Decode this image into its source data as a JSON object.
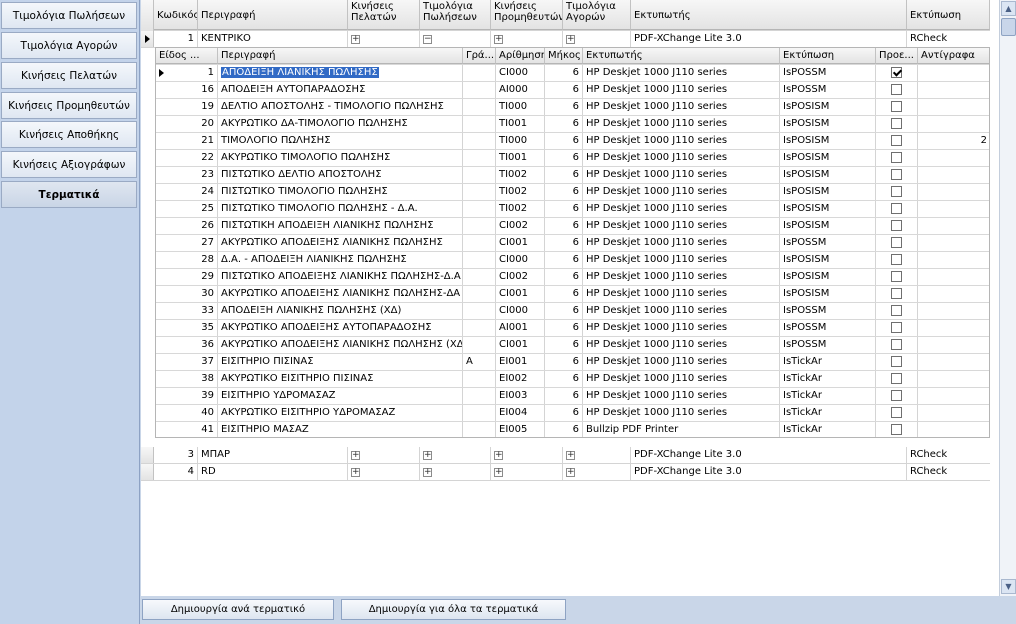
{
  "sidebar": {
    "items": [
      {
        "label": "Τιμολόγια Πωλήσεων"
      },
      {
        "label": "Τιμολόγια Αγορών"
      },
      {
        "label": "Κινήσεις Πελατών"
      },
      {
        "label": "Κινήσεις Προμηθευτών"
      },
      {
        "label": "Κινήσεις Αποθήκης"
      },
      {
        "label": "Κινήσεις Αξιογράφων"
      },
      {
        "label": "Τερματικά"
      }
    ],
    "active_index": 6
  },
  "outer_grid": {
    "headers": [
      "Κωδικός",
      "Περιγραφή",
      "Κινήσεις Πελατών",
      "Τιμολόγια Πωλήσεων",
      "Κινήσεις Προμηθευτών",
      "Τιμολόγια Αγορών",
      "Εκτυπωτής",
      "Εκτύπωση"
    ],
    "rows": [
      {
        "code": "1",
        "description": "ΚΕΝΤΡΙΚΟ",
        "printer": "PDF-XChange Lite 3.0",
        "print": "RCheck",
        "expanded_col": 3
      },
      {
        "code": "3",
        "description": "ΜΠΑΡ",
        "printer": "PDF-XChange Lite 3.0",
        "print": "RCheck",
        "expanded_col": 0
      },
      {
        "code": "4",
        "description": "RD",
        "printer": "PDF-XChange Lite 3.0",
        "print": "RCheck",
        "expanded_col": 0
      }
    ]
  },
  "detail_grid": {
    "headers": [
      "Είδος ...",
      "Περιγραφή",
      "Γρά...",
      "Αρίθμηση",
      "Μήκος",
      "Εκτυπωτής",
      "Εκτύπωση",
      "Προε...",
      "Αντίγραφα"
    ],
    "rows": [
      {
        "type": "1",
        "description": "ΑΠΟΔΕΙΞΗ ΛΙΑΝΙΚΗΣ ΠΩΛΗΣΗΣ",
        "letter": "",
        "numbering": "CI000",
        "length": "6",
        "printer": "HP Deskjet 1000 J110 series",
        "print": "IsPOSSM",
        "default": true,
        "copies": "",
        "selected": true
      },
      {
        "type": "16",
        "description": "ΑΠΟΔΕΙΞΗ ΑΥΤΟΠΑΡΑΔΟΣΗΣ",
        "letter": "",
        "numbering": "AI000",
        "length": "6",
        "printer": "HP Deskjet 1000 J110 series",
        "print": "IsPOSSM",
        "default": false,
        "copies": ""
      },
      {
        "type": "19",
        "description": "ΔΕΛΤΙΟ ΑΠΟΣΤΟΛΗΣ - ΤΙΜΟΛΟΓΙΟ ΠΩΛΗΣΗΣ",
        "letter": "",
        "numbering": "TI000",
        "length": "6",
        "printer": "HP Deskjet 1000 J110 series",
        "print": "IsPOSISM",
        "default": false,
        "copies": ""
      },
      {
        "type": "20",
        "description": "ΑΚΥΡΩΤΙΚΟ ΔΑ-ΤΙΜΟΛΟΓΙΟ ΠΩΛΗΣΗΣ",
        "letter": "",
        "numbering": "TI001",
        "length": "6",
        "printer": "HP Deskjet 1000 J110 series",
        "print": "IsPOSISM",
        "default": false,
        "copies": ""
      },
      {
        "type": "21",
        "description": "ΤΙΜΟΛΟΓΙΟ ΠΩΛΗΣΗΣ",
        "letter": "",
        "numbering": "TI000",
        "length": "6",
        "printer": "HP Deskjet 1000 J110 series",
        "print": "IsPOSISM",
        "default": false,
        "copies": "2"
      },
      {
        "type": "22",
        "description": "ΑΚΥΡΩΤΙΚΟ ΤΙΜΟΛΟΓΙΟ ΠΩΛΗΣΗΣ",
        "letter": "",
        "numbering": "TI001",
        "length": "6",
        "printer": "HP Deskjet 1000 J110 series",
        "print": "IsPOSISM",
        "default": false,
        "copies": ""
      },
      {
        "type": "23",
        "description": "ΠΙΣΤΩΤΙΚΟ ΔΕΛΤΙΟ ΑΠΟΣΤΟΛΗΣ",
        "letter": "",
        "numbering": "TI002",
        "length": "6",
        "printer": "HP Deskjet 1000 J110 series",
        "print": "IsPOSISM",
        "default": false,
        "copies": ""
      },
      {
        "type": "24",
        "description": "ΠΙΣΤΩΤΙΚΟ ΤΙΜΟΛΟΓΙΟ ΠΩΛΗΣΗΣ",
        "letter": "",
        "numbering": "TI002",
        "length": "6",
        "printer": "HP Deskjet 1000 J110 series",
        "print": "IsPOSISM",
        "default": false,
        "copies": ""
      },
      {
        "type": "25",
        "description": "ΠΙΣΤΩΤΙΚΟ ΤΙΜΟΛΟΓΙΟ ΠΩΛΗΣΗΣ - Δ.Α.",
        "letter": "",
        "numbering": "TI002",
        "length": "6",
        "printer": "HP Deskjet 1000 J110 series",
        "print": "IsPOSISM",
        "default": false,
        "copies": ""
      },
      {
        "type": "26",
        "description": "ΠΙΣΤΩΤΙΚΗ ΑΠΟΔΕΙΞΗ ΛΙΑΝΙΚΗΣ ΠΩΛΗΣΗΣ",
        "letter": "",
        "numbering": "CI002",
        "length": "6",
        "printer": "HP Deskjet 1000 J110 series",
        "print": "IsPOSISM",
        "default": false,
        "copies": ""
      },
      {
        "type": "27",
        "description": "ΑΚΥΡΩΤΙΚΟ ΑΠΟΔΕΙΞΗΣ ΛΙΑΝΙΚΗΣ ΠΩΛΗΣΗΣ",
        "letter": "",
        "numbering": "CI001",
        "length": "6",
        "printer": "HP Deskjet 1000 J110 series",
        "print": "IsPOSSM",
        "default": false,
        "copies": ""
      },
      {
        "type": "28",
        "description": "Δ.Α. - ΑΠΟΔΕΙΞΗ ΛΙΑΝΙΚΗΣ ΠΩΛΗΣΗΣ",
        "letter": "",
        "numbering": "CI000",
        "length": "6",
        "printer": "HP Deskjet 1000 J110 series",
        "print": "IsPOSISM",
        "default": false,
        "copies": ""
      },
      {
        "type": "29",
        "description": "ΠΙΣΤΩΤΙΚΟ ΑΠΟΔΕΙΞΗΣ ΛΙΑΝΙΚΗΣ ΠΩΛΗΣΗΣ-Δ.Α",
        "letter": "",
        "numbering": "CI002",
        "length": "6",
        "printer": "HP Deskjet 1000 J110 series",
        "print": "IsPOSISM",
        "default": false,
        "copies": ""
      },
      {
        "type": "30",
        "description": "ΑΚΥΡΩΤΙΚΟ ΑΠΟΔΕΙΞΗΣ ΛΙΑΝΙΚΗΣ ΠΩΛΗΣΗΣ-ΔΑ",
        "letter": "",
        "numbering": "CI001",
        "length": "6",
        "printer": "HP Deskjet 1000 J110 series",
        "print": "IsPOSISM",
        "default": false,
        "copies": ""
      },
      {
        "type": "33",
        "description": "ΑΠΟΔΕΙΞΗ ΛΙΑΝΙΚΗΣ ΠΩΛΗΣΗΣ (ΧΔ)",
        "letter": "",
        "numbering": "CI000",
        "length": "6",
        "printer": "HP Deskjet 1000 J110 series",
        "print": "IsPOSSM",
        "default": false,
        "copies": ""
      },
      {
        "type": "35",
        "description": "ΑΚΥΡΩΤΙΚΟ ΑΠΟΔΕΙΞΗΣ ΑΥΤΟΠΑΡΑΔΟΣΗΣ",
        "letter": "",
        "numbering": "AI001",
        "length": "6",
        "printer": "HP Deskjet 1000 J110 series",
        "print": "IsPOSSM",
        "default": false,
        "copies": ""
      },
      {
        "type": "36",
        "description": "ΑΚΥΡΩΤΙΚΟ ΑΠΟΔΕΙΞΗΣ ΛΙΑΝΙΚΗΣ ΠΩΛΗΣΗΣ (ΧΔ)",
        "letter": "",
        "numbering": "CI001",
        "length": "6",
        "printer": "HP Deskjet 1000 J110 series",
        "print": "IsPOSSM",
        "default": false,
        "copies": ""
      },
      {
        "type": "37",
        "description": "ΕΙΣΙΤΗΡΙΟ ΠΙΣΙΝΑΣ",
        "letter": "A",
        "numbering": "EI001",
        "length": "6",
        "printer": "HP Deskjet 1000 J110 series",
        "print": "IsTickAr",
        "default": false,
        "copies": ""
      },
      {
        "type": "38",
        "description": "ΑΚΥΡΩΤΙΚΟ ΕΙΣΙΤΗΡΙΟ ΠΙΣΙΝΑΣ",
        "letter": "",
        "numbering": "EI002",
        "length": "6",
        "printer": "HP Deskjet 1000 J110 series",
        "print": "IsTickAr",
        "default": false,
        "copies": ""
      },
      {
        "type": "39",
        "description": "ΕΙΣΙΤΗΡΙΟ ΥΔΡΟΜΑΣΑΖ",
        "letter": "",
        "numbering": "EI003",
        "length": "6",
        "printer": "HP Deskjet 1000 J110 series",
        "print": "IsTickAr",
        "default": false,
        "copies": ""
      },
      {
        "type": "40",
        "description": "ΑΚΥΡΩΤΙΚΟ ΕΙΣΙΤΗΡΙΟ ΥΔΡΟΜΑΣΑΖ",
        "letter": "",
        "numbering": "EI004",
        "length": "6",
        "printer": "HP Deskjet 1000 J110 series",
        "print": "IsTickAr",
        "default": false,
        "copies": ""
      },
      {
        "type": "41",
        "description": "ΕΙΣΙΤΗΡΙΟ ΜΑΣΑΖ",
        "letter": "",
        "numbering": "EI005",
        "length": "6",
        "printer": "Bullzip PDF Printer",
        "print": "IsTickAr",
        "default": false,
        "copies": ""
      }
    ]
  },
  "buttons": {
    "per_terminal": "Δημιουργία ανά τερματικό",
    "all_terminals": "Δημιουργία για όλα τα τερματικά"
  }
}
